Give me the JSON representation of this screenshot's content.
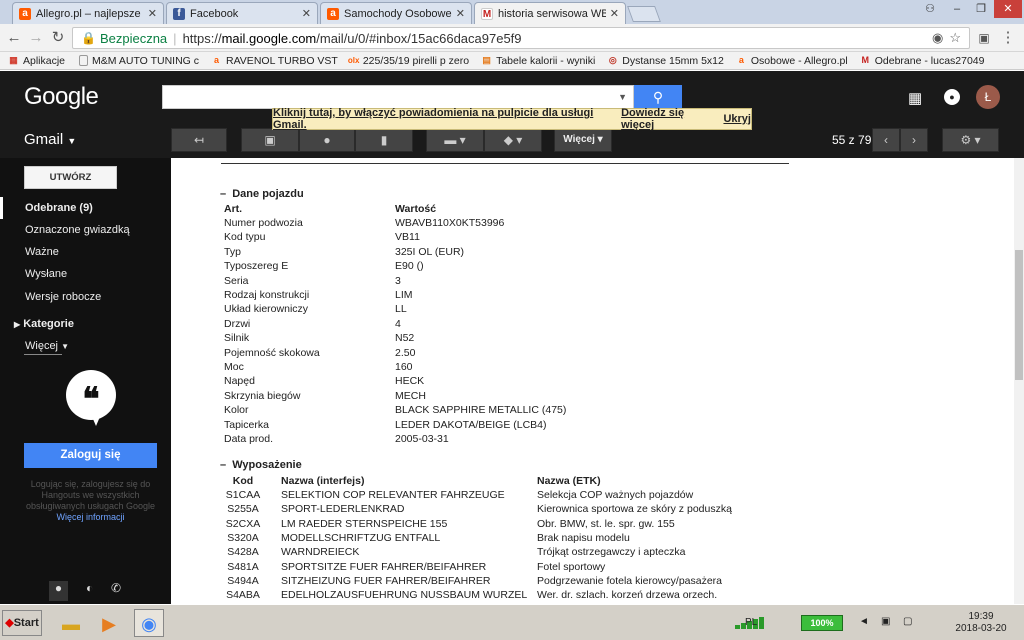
{
  "browser": {
    "tabs": [
      {
        "label": "Allegro.pl – najlepsze ceny",
        "icon": "allegro-icon",
        "color": "#ff5a00",
        "active": false
      },
      {
        "label": "Facebook",
        "icon": "facebook-icon",
        "color": "#3b5998",
        "active": false
      },
      {
        "label": "Samochody Osobowe now",
        "icon": "allegro-icon",
        "color": "#ff5a00",
        "active": false
      },
      {
        "label": "historia serwisowa WBAVB",
        "icon": "gmail-icon",
        "color": "#c5221f",
        "active": true
      }
    ],
    "security_label": "Bezpieczna",
    "url_prefix": "https://",
    "url_host": "mail.google.com",
    "url_rest": "/mail/u/0/#inbox/15ac66daca97e5f9",
    "bookmarks": [
      {
        "label": "Aplikacje",
        "icon": "apps-icon"
      },
      {
        "label": "M&M AUTO TUNING c",
        "icon": "page-icon"
      },
      {
        "label": "RAVENOL TURBO VST",
        "icon": "allegro-icon"
      },
      {
        "label": "225/35/19 pirelli p zero",
        "icon": "olx-icon"
      },
      {
        "label": "Tabele kalorii - wyniki",
        "icon": "doc-icon"
      },
      {
        "label": "Dystanse 15mm 5x12",
        "icon": "brand-icon"
      },
      {
        "label": "Osobowe - Allegro.pl",
        "icon": "allegro-icon"
      },
      {
        "label": "Odebrane - lucas27049",
        "icon": "gmail-icon"
      }
    ],
    "toolbar_icons": [
      "back-arrow-icon",
      "forward-arrow-icon",
      "reload-icon",
      "eye-icon",
      "star-icon",
      "extension-icon",
      "menu-icon"
    ]
  },
  "gmail": {
    "logo": "Google",
    "label": "Gmail",
    "avatar_letter": "Ł",
    "notification": {
      "text": "Kliknij tutaj, by włączyć powiadomienia na pulpicie dla usługi Gmail.",
      "more": "Dowiedz się więcej",
      "hide": "Ukryj"
    },
    "more_button": "Więcej",
    "pager": "55 z 79",
    "compose": "UTWÓRZ",
    "nav": [
      {
        "label": "Odebrane (9)",
        "active": true
      },
      {
        "label": "Oznaczone gwiazdką",
        "active": false
      },
      {
        "label": "Ważne",
        "active": false
      },
      {
        "label": "Wysłane",
        "active": false
      },
      {
        "label": "Wersje robocze",
        "active": false
      },
      {
        "label": "Kategorie",
        "active": false
      },
      {
        "label": "Więcej",
        "active": false
      }
    ],
    "hangouts": {
      "login_button": "Zaloguj się",
      "note": "Logując się, zalogujesz się do Hangouts we wszystkich obsługiwanych usługach Google",
      "more_info": "Więcej informacji"
    }
  },
  "email": {
    "vehicle_section": "Dane pojazdu",
    "vehicle_header": {
      "k": "Art.",
      "v": "Wartość"
    },
    "vehicle": [
      {
        "k": "Numer podwozia",
        "v": "WBAVB110X0KT53996"
      },
      {
        "k": "Kod typu",
        "v": "VB11"
      },
      {
        "k": "Typ",
        "v": "325I OL (EUR)"
      },
      {
        "k": "Typoszereg E",
        "v": "E90 ()"
      },
      {
        "k": "Seria",
        "v": "3"
      },
      {
        "k": "Rodzaj konstrukcji",
        "v": "LIM"
      },
      {
        "k": "Układ kierowniczy",
        "v": "LL"
      },
      {
        "k": "Drzwi",
        "v": "4"
      },
      {
        "k": "Silnik",
        "v": "N52"
      },
      {
        "k": "Pojemność skokowa",
        "v": "2.50"
      },
      {
        "k": "Moc",
        "v": "160"
      },
      {
        "k": "Napęd",
        "v": "HECK"
      },
      {
        "k": "Skrzynia biegów",
        "v": "MECH"
      },
      {
        "k": "Kolor",
        "v": "BLACK SAPPHIRE METALLIC (475)"
      },
      {
        "k": "Tapicerka",
        "v": "LEDER DAKOTA/BEIGE (LCB4)"
      },
      {
        "k": "Data prod.",
        "v": "2005-03-31"
      }
    ],
    "equipment_section": "Wyposażenie",
    "equipment_header": {
      "c": "Kod",
      "n": "Nazwa (interfejs)",
      "e": "Nazwa (ETK)"
    },
    "equipment": [
      {
        "c": "S1CAA",
        "n": "SELEKTION COP RELEVANTER FAHRZEUGE",
        "e": "Selekcja COP ważnych pojazdów"
      },
      {
        "c": "S255A",
        "n": "SPORT-LEDERLENKRAD",
        "e": "Kierownica sportowa ze skóry z poduszką"
      },
      {
        "c": "S2CXA",
        "n": "LM RAEDER STERNSPEICHE 155",
        "e": "Obr. BMW, st. le. spr. gw. 155"
      },
      {
        "c": "S320A",
        "n": "MODELLSCHRIFTZUG ENTFALL",
        "e": "Brak napisu modelu"
      },
      {
        "c": "S428A",
        "n": "WARNDREIECK",
        "e": "Trójkąt ostrzegawczy i apteczka"
      },
      {
        "c": "S481A",
        "n": "SPORTSITZE FUER FAHRER/BEIFAHRER",
        "e": "Fotel sportowy"
      },
      {
        "c": "S494A",
        "n": "SITZHEIZUNG FUER FAHRER/BEIFAHRER",
        "e": "Podgrzewanie fotela kierowcy/pasażera"
      },
      {
        "c": "S4ABA",
        "n": "EDELHOLZAUSFUEHRUNG NUSSBAUM WURZEL",
        "e": "Wer. dr. szlach. korzeń drzewa orzech."
      }
    ]
  },
  "taskbar": {
    "start": "Start",
    "lang": "PL",
    "battery": "100%",
    "time": "19:39",
    "date": "2018-03-20"
  }
}
